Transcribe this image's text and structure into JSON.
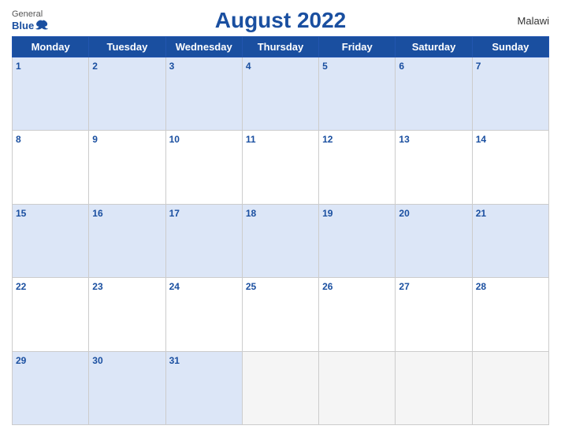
{
  "header": {
    "logo_general": "General",
    "logo_blue": "Blue",
    "title": "August 2022",
    "country": "Malawi"
  },
  "days_of_week": [
    "Monday",
    "Tuesday",
    "Wednesday",
    "Thursday",
    "Friday",
    "Saturday",
    "Sunday"
  ],
  "weeks": [
    [
      1,
      2,
      3,
      4,
      5,
      6,
      7
    ],
    [
      8,
      9,
      10,
      11,
      12,
      13,
      14
    ],
    [
      15,
      16,
      17,
      18,
      19,
      20,
      21
    ],
    [
      22,
      23,
      24,
      25,
      26,
      27,
      28
    ],
    [
      29,
      30,
      31,
      null,
      null,
      null,
      null
    ]
  ]
}
